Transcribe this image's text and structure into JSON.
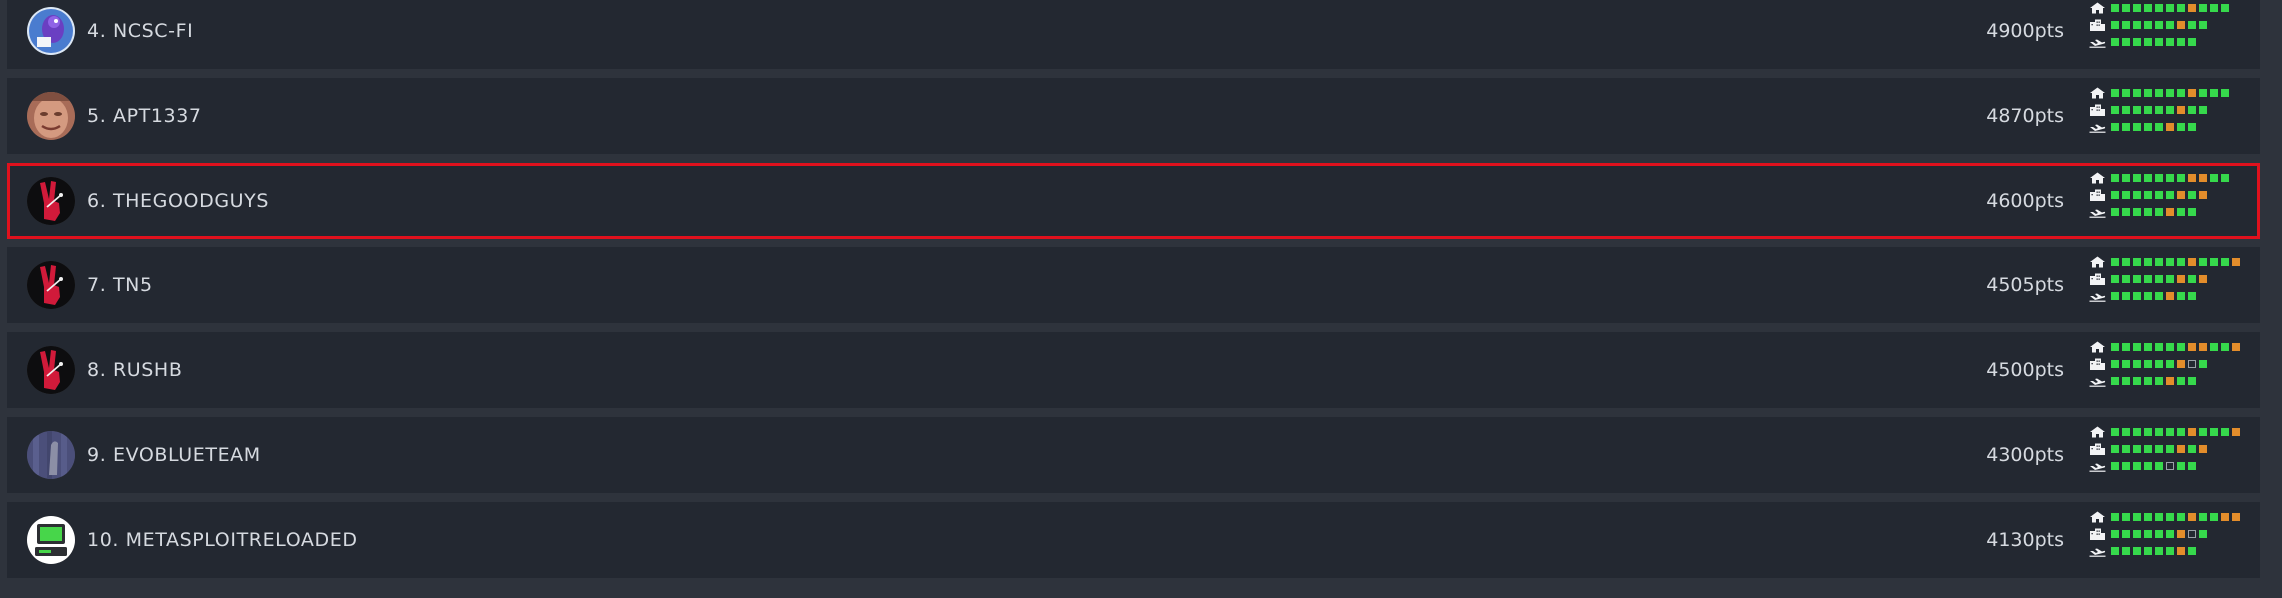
{
  "colors": {
    "solved": "#36d94c",
    "partial": "#e38d2b",
    "unsolved": "#9aa0a8",
    "highlight": "#e0111d",
    "row_bg": "#232831",
    "page_bg": "#2e333c"
  },
  "category_icons": [
    "home-icon",
    "office-building-icon",
    "airplane-icon"
  ],
  "teams": [
    {
      "label": "4. NCSC-FI",
      "points": "4900pts",
      "avatar": "ncsc-fi-logo",
      "highlighted": false,
      "status": [
        "gggggggoggg",
        "ggggggogg",
        "gggggggg"
      ]
    },
    {
      "label": "5. APT1337",
      "points": "4870pts",
      "avatar": "face-photo",
      "highlighted": false,
      "status": [
        "gggggggoggg",
        "ggggggogg",
        "gggggogg"
      ]
    },
    {
      "label": "6. THEGOODGUYS",
      "points": "4600pts",
      "avatar": "peace-hand",
      "highlighted": true,
      "status": [
        "gggggggoogg",
        "ggggggogo",
        "gggggogg"
      ]
    },
    {
      "label": "7. TN5",
      "points": "4505pts",
      "avatar": "peace-hand",
      "highlighted": false,
      "status": [
        "gggggggogggo",
        "ggggggogo",
        "gggggogg"
      ]
    },
    {
      "label": "8. RUSHB",
      "points": "4500pts",
      "avatar": "peace-hand",
      "highlighted": false,
      "status": [
        "gggggggooggo",
        "ggggggoeg",
        "gggggogg"
      ]
    },
    {
      "label": "9. EVOBLUETEAM",
      "points": "4300pts",
      "avatar": "blue-texture",
      "highlighted": false,
      "status": [
        "gggggggogggo",
        "ggggggogo",
        "gggggegg"
      ]
    },
    {
      "label": "10. METASPLOITRELOADED",
      "points": "4130pts",
      "avatar": "computer-logo",
      "highlighted": false,
      "status": [
        "gggggggoggoo",
        "ggggggoeg",
        "ggggggog"
      ]
    }
  ]
}
